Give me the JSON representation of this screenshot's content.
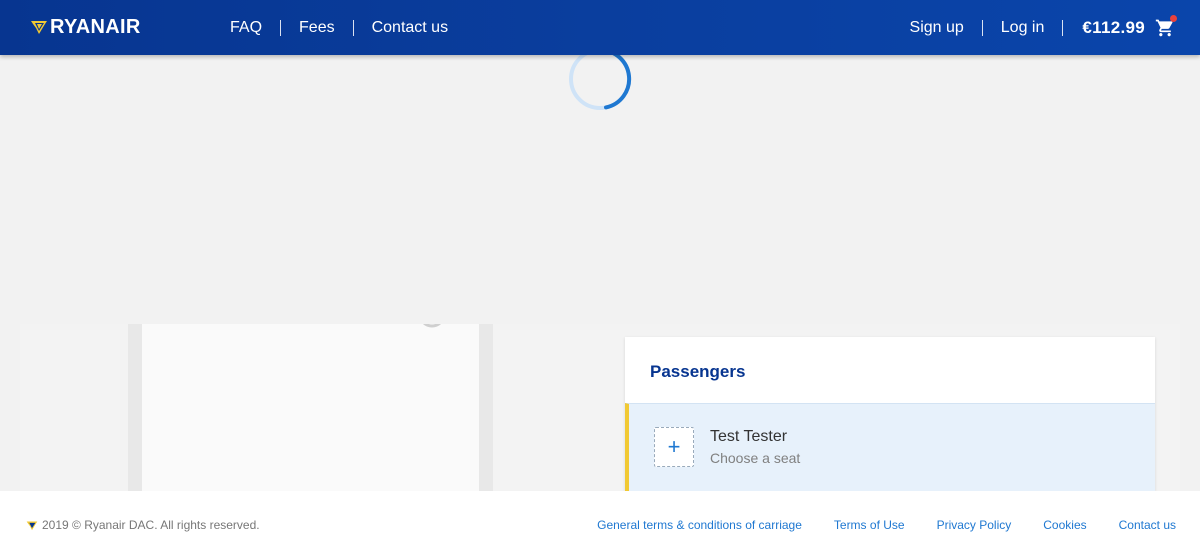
{
  "header": {
    "brand": "RYANAIR",
    "nav": [
      {
        "label": "FAQ"
      },
      {
        "label": "Fees"
      },
      {
        "label": "Contact us"
      }
    ],
    "sign_up": "Sign up",
    "log_in": "Log in",
    "cart_total": "€112.99"
  },
  "passengers": {
    "title": "Passengers",
    "list": [
      {
        "name": "Test Tester",
        "seat_status": "Choose a seat",
        "add_symbol": "+"
      }
    ]
  },
  "footer": {
    "copyright": "2019 © Ryanair DAC. All rights reserved.",
    "links": [
      "General terms & conditions of carriage",
      "Terms of Use",
      "Privacy Policy",
      "Cookies",
      "Contact us"
    ]
  },
  "colors": {
    "header_blue": "#073590",
    "accent_yellow": "#f1c933",
    "link_blue": "#1f78d1",
    "cart_badge": "#e8413b"
  },
  "icons": [
    "harp-logo-icon",
    "cart-icon",
    "loading-spinner-icon"
  ]
}
